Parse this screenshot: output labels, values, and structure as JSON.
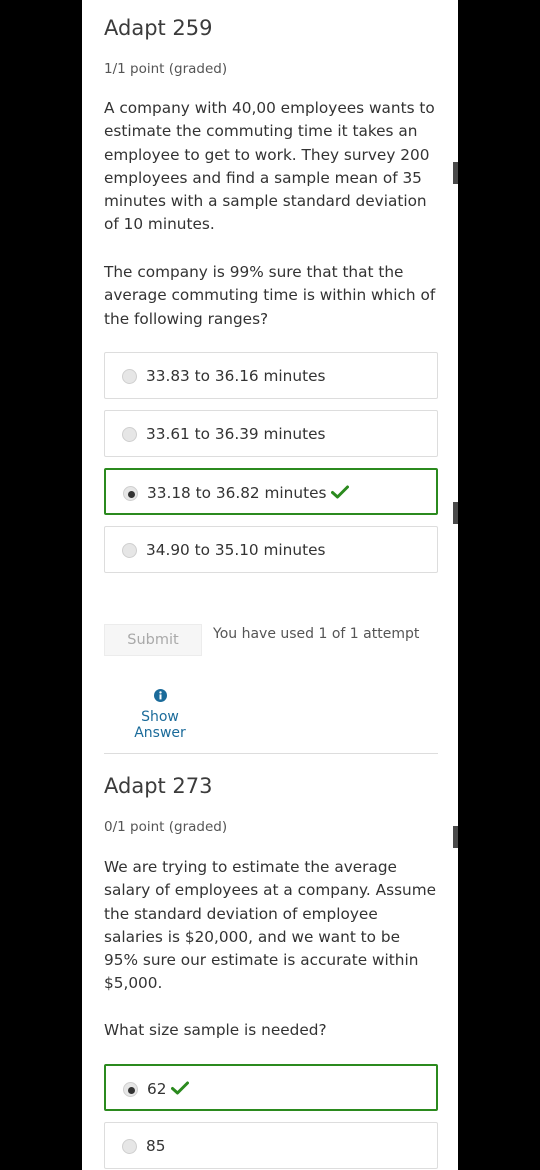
{
  "problem1": {
    "title": "Adapt 259",
    "points": "1/1 point (graded)",
    "question_p1": "A company with 40,00 employees wants to estimate the commuting time it takes an employee to get to work. They survey 200 employees and find a sample mean of 35 minutes with a sample standard deviation of 10 minutes.",
    "question_p2": "The company is 99% sure that that the average commuting time is within which of the following ranges?",
    "choices": [
      {
        "label": "33.83 to 36.16 minutes",
        "selected": false,
        "correct": false
      },
      {
        "label": "33.61 to 36.39 minutes",
        "selected": false,
        "correct": false
      },
      {
        "label": "33.18 to 36.82 minutes",
        "selected": true,
        "correct": true
      },
      {
        "label": "34.90 to 35.10 minutes",
        "selected": false,
        "correct": false
      }
    ],
    "submit_label": "Submit",
    "attempts_text": "You have used 1 of 1 attempt",
    "show_answer_label": "Show Answer"
  },
  "problem2": {
    "title": "Adapt 273",
    "points": "0/1 point (graded)",
    "question_p1": "We are trying to estimate the average salary of employees at a company. Assume the standard deviation of employee salaries is $20,000, and we want to be 95% sure our estimate is accurate within $5,000.",
    "question_p2": "What size sample is needed?",
    "choices": [
      {
        "label": "62",
        "selected": true,
        "correct": true
      },
      {
        "label": "85",
        "selected": false,
        "correct": false
      }
    ]
  },
  "colors": {
    "correct_green": "#2b8a1e",
    "link_blue": "#1b6b9a",
    "background": "#000000"
  },
  "icons": {
    "correct": "check-icon",
    "info": "info-icon"
  }
}
